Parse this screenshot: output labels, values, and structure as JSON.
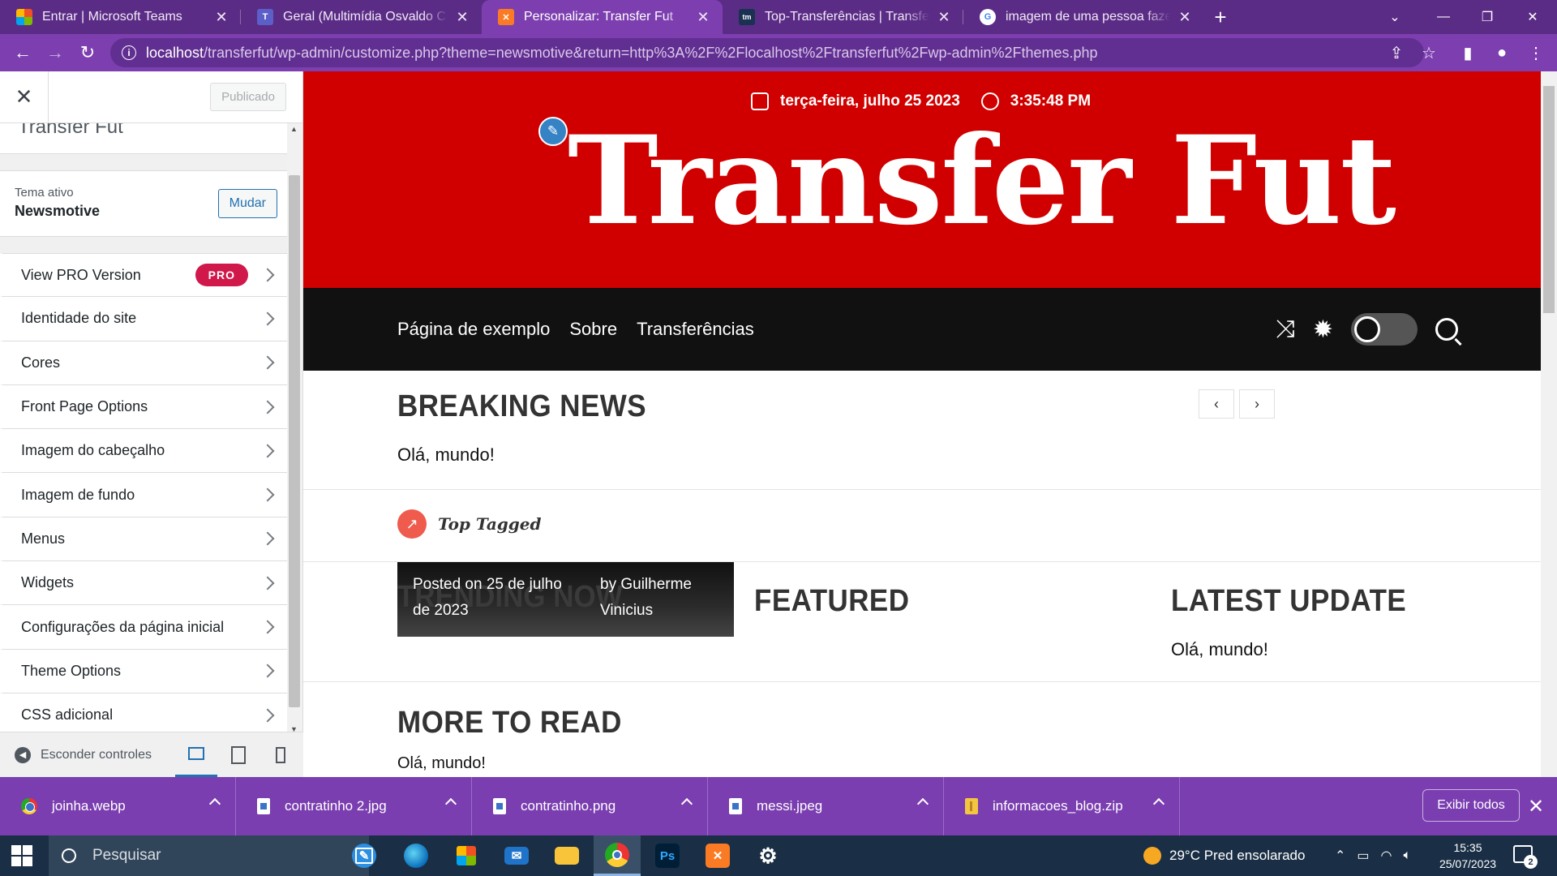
{
  "browser": {
    "tabs": [
      {
        "title": "Entrar | Microsoft Teams",
        "icon": "microsoft-icon",
        "active": false
      },
      {
        "title": "Geral (Multimídia Osvaldo Cruz T",
        "icon": "teams-icon",
        "active": false
      },
      {
        "title": "Personalizar: Transfer Fut",
        "icon": "xampp-icon",
        "active": true
      },
      {
        "title": "Top-Transferências | Transfermark",
        "icon": "transfermarkt-icon",
        "active": false
      },
      {
        "title": "imagem de uma pessoa fazendo",
        "icon": "google-icon",
        "active": false
      }
    ],
    "url_host": "localhost",
    "url_rest": "/transferfut/wp-admin/customize.php?theme=newsmotive&return=http%3A%2F%2Flocalhost%2Ftransferfut%2Fwp-admin%2Fthemes.php"
  },
  "customizer": {
    "publish_label": "Publicado",
    "site_title_partial": "Transfer Fut",
    "active_theme_label": "Tema ativo",
    "active_theme_name": "Newsmotive",
    "change_label": "Mudar",
    "pro_badge": "PRO",
    "items": [
      "View PRO Version",
      "Identidade do site",
      "Cores",
      "Front Page Options",
      "Imagem do cabeçalho",
      "Imagem de fundo",
      "Menus",
      "Widgets",
      "Configurações da página inicial",
      "Theme Options",
      "CSS adicional"
    ],
    "hide_controls": "Esconder controles"
  },
  "site": {
    "date": "terça-feira, julho 25 2023",
    "time": "3:35:48 PM",
    "name": "Transfer Fut",
    "menu": [
      "Página de exemplo",
      "Sobre",
      "Transferências"
    ],
    "breaking_title": "BREAKING NEWS",
    "breaking_post": "Olá, mundo!",
    "top_tagged": "Top Tagged",
    "trending_title": "TRENDING NOW",
    "posted": "Posted on 25 de julho de 2023",
    "by": "by Guilherme Vinicius",
    "featured_title": "FEATURED",
    "latest_title": "LATEST UPDATE",
    "latest_post": "Olá, mundo!",
    "more_title": "MORE TO READ",
    "more_post": "Olá, mundo!",
    "header_color": "#d10000"
  },
  "downloads": {
    "items": [
      "joinha.webp",
      "contratinho 2.jpg",
      "contratinho.png",
      "messi.jpeg",
      "informacoes_blog.zip"
    ],
    "show_all": "Exibir todos"
  },
  "taskbar": {
    "search_placeholder": "Pesquisar",
    "weather": "29°C  Pred ensolarado",
    "time": "15:35",
    "date": "25/07/2023",
    "notifications": "2",
    "apps": [
      "task-view-icon",
      "edge-icon",
      "store-icon",
      "mail-icon",
      "file-explorer-icon",
      "chrome-icon",
      "photoshop-icon",
      "xampp-icon",
      "settings-icon"
    ]
  }
}
